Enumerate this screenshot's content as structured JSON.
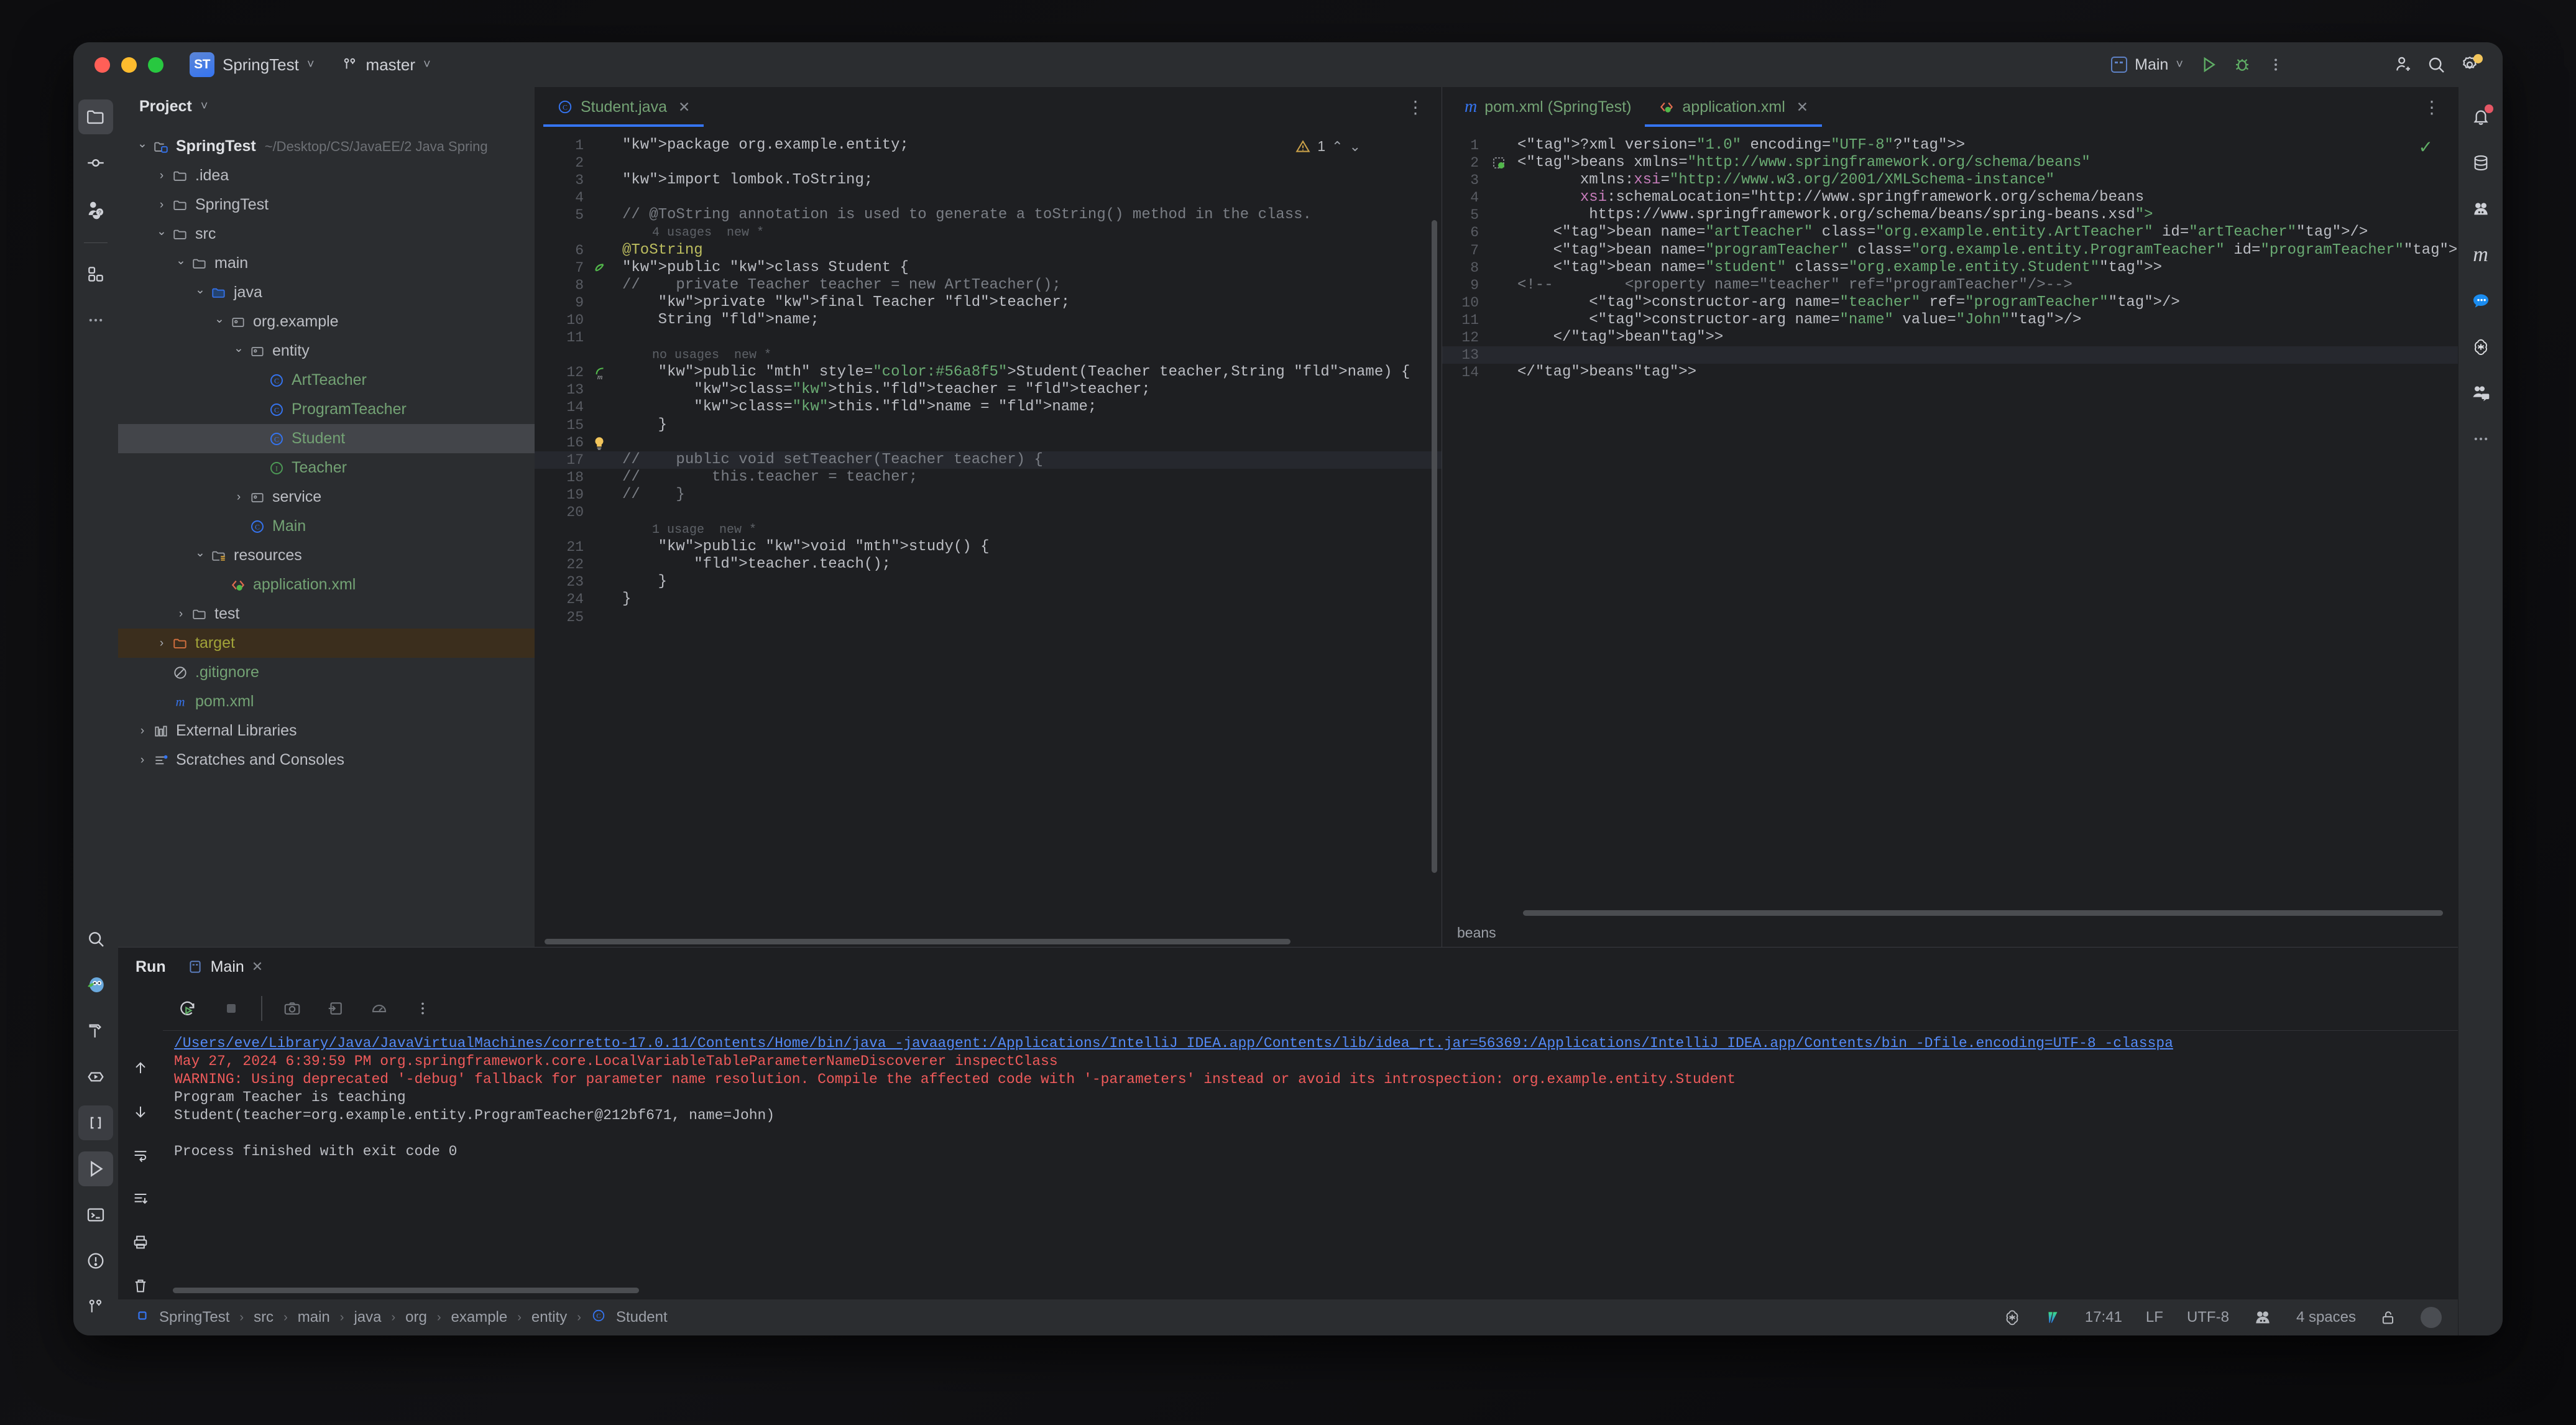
{
  "titlebar": {
    "project_badge": "ST",
    "project_name": "SpringTest",
    "branch": "master",
    "run_config": "Main",
    "icons": [
      "run-icon",
      "debug-icon",
      "more-actions-icon",
      "add-collaborator-icon",
      "search-everywhere-icon",
      "settings-icon"
    ]
  },
  "left_stripe": {
    "items": [
      {
        "name": "project-tool-window",
        "icon": "folder-icon",
        "active": true
      },
      {
        "name": "commit-tool-window",
        "icon": "commit-icon",
        "active": false
      },
      {
        "name": "pull-requests-tool-window",
        "icon": "pull-request-icon",
        "active": false
      },
      {
        "name": "structure-tool-window",
        "icon": "structure-icon",
        "active": false
      },
      {
        "name": "more-tool-windows",
        "icon": "more-dots-icon",
        "active": false
      }
    ],
    "bottom_items": [
      {
        "name": "find-tool-window",
        "icon": "search-icon",
        "active": false
      },
      {
        "name": "spring-tool-window",
        "icon": "spring-owl-icon",
        "active": false
      },
      {
        "name": "build-tool-window",
        "icon": "hammer-icon",
        "active": false
      },
      {
        "name": "services-tool-window",
        "icon": "services-icon",
        "active": false
      },
      {
        "name": "bean-validation-icon",
        "icon": "brackets-icon",
        "active": false
      },
      {
        "name": "run-tool-window",
        "icon": "run-triangle-icon",
        "active": true
      },
      {
        "name": "terminal-tool-window",
        "icon": "terminal-icon",
        "active": false
      },
      {
        "name": "problems-tool-window",
        "icon": "warning-circle-icon",
        "active": false
      },
      {
        "name": "version-control-tool-window",
        "icon": "branch-icon",
        "active": false
      }
    ]
  },
  "right_stripe": {
    "items": [
      {
        "name": "notifications",
        "icon": "bell-icon",
        "badge": true
      },
      {
        "name": "database",
        "icon": "database-icon",
        "badge": false
      },
      {
        "name": "ai-assistant",
        "icon": "people-icon",
        "badge": false
      },
      {
        "name": "maven",
        "icon": "maven-m-icon",
        "badge": false
      },
      {
        "name": "chat",
        "icon": "chat-bubble-icon",
        "badge": false
      },
      {
        "name": "openai",
        "icon": "openai-icon",
        "badge": false
      },
      {
        "name": "code-with-me",
        "icon": "code-with-me-icon",
        "badge": false
      },
      {
        "name": "more-tool-windows",
        "icon": "more-dots-icon",
        "badge": false
      }
    ]
  },
  "project_panel": {
    "title": "Project",
    "tree": [
      {
        "depth": 0,
        "arrow": "down",
        "icon": "module-folder-icon",
        "label": "SpringTest",
        "bold": true,
        "path": "~/Desktop/CS/JavaEE/2 Java Spring",
        "state": "normal"
      },
      {
        "depth": 1,
        "arrow": "right",
        "icon": "folder-icon",
        "label": ".idea",
        "bold": false,
        "state": "normal"
      },
      {
        "depth": 1,
        "arrow": "right",
        "icon": "folder-icon",
        "label": "SpringTest",
        "bold": false,
        "state": "normal"
      },
      {
        "depth": 1,
        "arrow": "down",
        "icon": "folder-icon",
        "label": "src",
        "bold": false,
        "state": "normal"
      },
      {
        "depth": 2,
        "arrow": "down",
        "icon": "folder-icon",
        "label": "main",
        "bold": false,
        "state": "normal"
      },
      {
        "depth": 3,
        "arrow": "down",
        "icon": "source-folder-icon",
        "label": "java",
        "bold": false,
        "state": "normal"
      },
      {
        "depth": 4,
        "arrow": "down",
        "icon": "package-icon",
        "label": "org.example",
        "bold": false,
        "state": "normal"
      },
      {
        "depth": 5,
        "arrow": "down",
        "icon": "package-icon",
        "label": "entity",
        "bold": false,
        "state": "normal"
      },
      {
        "depth": 6,
        "arrow": "none",
        "icon": "java-class-icon",
        "label": "ArtTeacher",
        "bold": false,
        "state": "green"
      },
      {
        "depth": 6,
        "arrow": "none",
        "icon": "java-class-icon",
        "label": "ProgramTeacher",
        "bold": false,
        "state": "green"
      },
      {
        "depth": 6,
        "arrow": "none",
        "icon": "java-class-icon",
        "label": "Student",
        "bold": false,
        "state": "green",
        "selected": true
      },
      {
        "depth": 6,
        "arrow": "none",
        "icon": "java-interface-icon",
        "label": "Teacher",
        "bold": false,
        "state": "green"
      },
      {
        "depth": 5,
        "arrow": "right",
        "icon": "package-icon",
        "label": "service",
        "bold": false,
        "state": "normal"
      },
      {
        "depth": 5,
        "arrow": "none",
        "icon": "java-class-icon",
        "label": "Main",
        "bold": false,
        "state": "green"
      },
      {
        "depth": 3,
        "arrow": "down",
        "icon": "resources-folder-icon",
        "label": "resources",
        "bold": false,
        "state": "normal"
      },
      {
        "depth": 4,
        "arrow": "none",
        "icon": "spring-xml-icon",
        "label": "application.xml",
        "bold": false,
        "state": "green"
      },
      {
        "depth": 2,
        "arrow": "right",
        "icon": "folder-icon",
        "label": "test",
        "bold": false,
        "state": "normal"
      },
      {
        "depth": 1,
        "arrow": "right",
        "icon": "excluded-folder-icon",
        "label": "target",
        "bold": false,
        "state": "olive",
        "highlight": true
      },
      {
        "depth": 1,
        "arrow": "none",
        "icon": "gitignore-icon",
        "label": ".gitignore",
        "bold": false,
        "state": "green"
      },
      {
        "depth": 1,
        "arrow": "none",
        "icon": "maven-m-icon",
        "label": "pom.xml",
        "bold": false,
        "state": "green"
      },
      {
        "depth": 0,
        "arrow": "right",
        "icon": "external-libraries-icon",
        "label": "External Libraries",
        "bold": false,
        "state": "normal"
      },
      {
        "depth": 0,
        "arrow": "right",
        "icon": "scratches-icon",
        "label": "Scratches and Consoles",
        "bold": false,
        "state": "normal"
      }
    ]
  },
  "editor_left": {
    "tabs": [
      {
        "label": "Student.java",
        "icon": "java-class-icon",
        "active": true,
        "closable": true
      }
    ],
    "inspection_count": "1",
    "lines": [
      {
        "n": "1",
        "text": "package org.example.entity;",
        "type": "code"
      },
      {
        "n": "2",
        "text": "",
        "type": "code"
      },
      {
        "n": "3",
        "text": "import lombok.ToString;",
        "type": "code"
      },
      {
        "n": "4",
        "text": "",
        "type": "code"
      },
      {
        "n": "5",
        "text": "// @ToString annotation is used to generate a toString() method in the class.",
        "type": "comment"
      },
      {
        "n": "",
        "text": "4 usages  new *",
        "type": "hint"
      },
      {
        "n": "6",
        "text": "@ToString",
        "type": "code"
      },
      {
        "n": "7",
        "text": "public class Student {",
        "type": "code",
        "gutter_icon": "bean-icon"
      },
      {
        "n": "8",
        "text": "//    private Teacher teacher = new ArtTeacher();",
        "type": "comment"
      },
      {
        "n": "9",
        "text": "    private final Teacher teacher;",
        "type": "code"
      },
      {
        "n": "10",
        "text": "    String name;",
        "type": "code"
      },
      {
        "n": "11",
        "text": "",
        "type": "code"
      },
      {
        "n": "",
        "text": "no usages  new *",
        "type": "hint"
      },
      {
        "n": "12",
        "text": "    public Student(Teacher teacher,String name) {",
        "type": "code",
        "gutter_icon": "bean-method-icon"
      },
      {
        "n": "13",
        "text": "        this.teacher = teacher;",
        "type": "code"
      },
      {
        "n": "14",
        "text": "        this.name = name;",
        "type": "code"
      },
      {
        "n": "15",
        "text": "    }",
        "type": "code"
      },
      {
        "n": "16",
        "text": "",
        "type": "code",
        "gutter_icon": "intention-bulb-icon"
      },
      {
        "n": "17",
        "text": "//    public void setTeacher(Teacher teacher) {",
        "type": "comment",
        "highlight": true
      },
      {
        "n": "18",
        "text": "//        this.teacher = teacher;",
        "type": "comment"
      },
      {
        "n": "19",
        "text": "//    }",
        "type": "comment"
      },
      {
        "n": "20",
        "text": "",
        "type": "code"
      },
      {
        "n": "",
        "text": "1 usage  new *",
        "type": "hint"
      },
      {
        "n": "21",
        "text": "    public void study() {",
        "type": "code"
      },
      {
        "n": "22",
        "text": "        teacher.teach();",
        "type": "code"
      },
      {
        "n": "23",
        "text": "    }",
        "type": "code"
      },
      {
        "n": "24",
        "text": "}",
        "type": "code"
      },
      {
        "n": "25",
        "text": "",
        "type": "code"
      }
    ]
  },
  "editor_right": {
    "tabs": [
      {
        "label": "pom.xml (SpringTest)",
        "icon": "maven-m-icon",
        "active": false,
        "closable": false
      },
      {
        "label": "application.xml",
        "icon": "spring-xml-icon",
        "active": true,
        "closable": true
      }
    ],
    "breadcrumb": "beans",
    "lines": [
      {
        "n": "1",
        "text": "<?xml version=\"1.0\" encoding=\"UTF-8\"?>"
      },
      {
        "n": "2",
        "text": "<beans xmlns=\"http://www.springframework.org/schema/beans\"",
        "gutter_icon": "spring-bean-icon"
      },
      {
        "n": "3",
        "text": "       xmlns:xsi=\"http://www.w3.org/2001/XMLSchema-instance\""
      },
      {
        "n": "4",
        "text": "       xsi:schemaLocation=\"http://www.springframework.org/schema/beans"
      },
      {
        "n": "5",
        "text": "        https://www.springframework.org/schema/beans/spring-beans.xsd\">"
      },
      {
        "n": "6",
        "text": "    <bean name=\"artTeacher\" class=\"org.example.entity.ArtTeacher\" id=\"artTeacher\"/>"
      },
      {
        "n": "7",
        "text": "    <bean name=\"programTeacher\" class=\"org.example.entity.ProgramTeacher\" id=\"programTeacher\"/>"
      },
      {
        "n": "8",
        "text": "    <bean name=\"student\" class=\"org.example.entity.Student\">"
      },
      {
        "n": "9",
        "text": "<!--        <property name=\"teacher\" ref=\"programTeacher\"/>-->",
        "comment": true
      },
      {
        "n": "10",
        "text": "        <constructor-arg name=\"teacher\" ref=\"programTeacher\"/>"
      },
      {
        "n": "11",
        "text": "        <constructor-arg name=\"name\" value=\"John\"/>"
      },
      {
        "n": "12",
        "text": "    </bean>"
      },
      {
        "n": "13",
        "text": "",
        "highlight": true
      },
      {
        "n": "14",
        "text": "</beans>"
      }
    ]
  },
  "run_panel": {
    "title": "Run",
    "tab_label": "Main",
    "toolbar_icons": [
      "rerun-icon",
      "stop-icon",
      "screenshot-icon",
      "export-icon",
      "profiler-icon",
      "more-icon"
    ],
    "side_icons": [
      "scroll-up-icon",
      "scroll-down-icon",
      "soft-wrap-icon",
      "scroll-to-end-icon",
      "print-icon",
      "clear-icon"
    ],
    "console": [
      {
        "text": "/Users/eve/Library/Java/JavaVirtualMachines/corretto-17.0.11/Contents/Home/bin/java -javaagent:/Applications/IntelliJ IDEA.app/Contents/lib/idea_rt.jar=56369:/Applications/IntelliJ IDEA.app/Contents/bin -Dfile.encoding=UTF-8 -classpa",
        "style": "link"
      },
      {
        "text": "May 27, 2024 6:39:59 PM org.springframework.core.LocalVariableTableParameterNameDiscoverer inspectClass",
        "style": "red"
      },
      {
        "text": "WARNING: Using deprecated '-debug' fallback for parameter name resolution. Compile the affected code with '-parameters' instead or avoid its introspection: org.example.entity.Student",
        "style": "red"
      },
      {
        "text": "Program Teacher is teaching",
        "style": "normal"
      },
      {
        "text": "Student(teacher=org.example.entity.ProgramTeacher@212bf671, name=John)",
        "style": "normal"
      },
      {
        "text": "",
        "style": "normal"
      },
      {
        "text": "Process finished with exit code 0",
        "style": "normal"
      }
    ]
  },
  "statusbar": {
    "breadcrumb": [
      "SpringTest",
      "src",
      "main",
      "java",
      "org",
      "example",
      "entity",
      "Student"
    ],
    "position": "17:41",
    "line_separator": "LF",
    "encoding": "UTF-8",
    "indent": "4 spaces",
    "right_icons": [
      "openai-icon",
      "vpn-icon",
      "inspection-people-icon",
      "lock-icon",
      "avatar"
    ]
  },
  "colors": {
    "accent": "#3574f0",
    "panel_bg": "#2b2d30",
    "editor_bg": "#1e1f22",
    "text": "#bcbec4",
    "green": "#73a274",
    "keyword": "#cf8e6d",
    "string": "#6aab73",
    "comment": "#7a7e85",
    "field": "#c77dbb",
    "tag": "#e8bf6a",
    "error_red": "#f05b5b"
  }
}
